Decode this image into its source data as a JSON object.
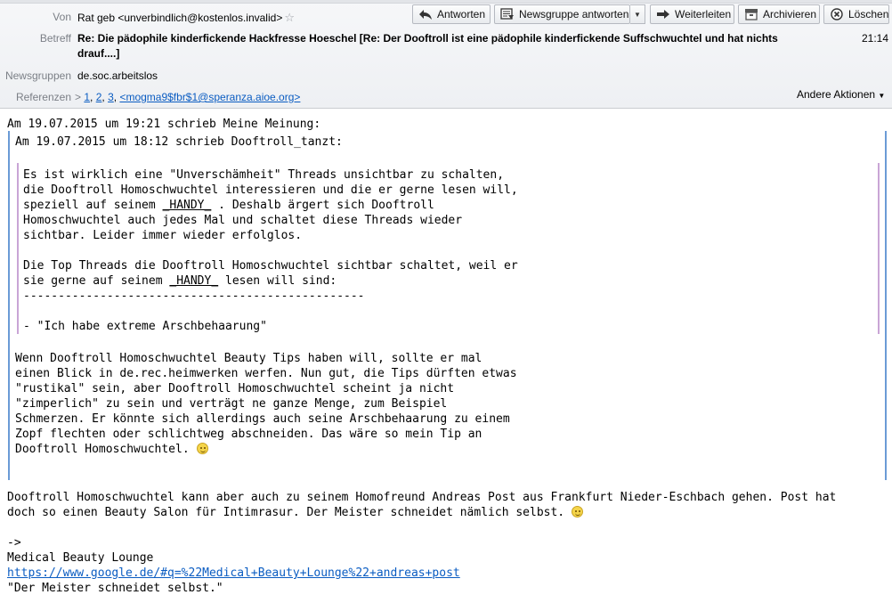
{
  "header": {
    "from_label": "Von",
    "from_value": "Rat geb <unverbindlich@kostenlos.invalid>",
    "subject_label": "Betreff",
    "subject_line1": "Re: Die pädophile kinderfickende Hackfresse Hoeschel [Re: Der Dooftroll ist eine pädophile kinderfickende Suffschwuchtel und hat nichts",
    "subject_line2": "drauf....]",
    "time": "21:14",
    "newsgroups_label": "Newsgruppen",
    "newsgroups_value": "de.soc.arbeitslos",
    "references_label": "Referenzen",
    "ref_1": "1",
    "ref_2": "2",
    "ref_3": "3",
    "ref_msgid": "<mogma9$fbr$1@speranza.aioe.org>",
    "other_actions": "Andere Aktionen"
  },
  "toolbar": {
    "reply": "Antworten",
    "reply_newsgroup": "Newsgruppe antworten",
    "forward": "Weiterleiten",
    "archive": "Archivieren",
    "delete": "Löschen"
  },
  "body": {
    "attribution_outer": "Am 19.07.2015 um 19:21 schrieb Meine Meinung:",
    "attribution_inner": "Am 19.07.2015 um 18:12 schrieb Dooftroll_tanzt:",
    "q2_l1": "Es ist wirklich eine \"Unverschämheit\" Threads unsichtbar zu schalten,",
    "q2_l2": "die Dooftroll Homoschwuchtel interessieren und die er gerne lesen will,",
    "q2_l3a": "speziell auf seinem ",
    "q2_l3b": "_HANDY_",
    "q2_l3c": " . Deshalb ärgert sich Dooftroll",
    "q2_l4": "Homoschwuchtel auch jedes Mal und schaltet diese Threads wieder",
    "q2_l5": "sichtbar. Leider immer wieder erfolglos.",
    "q2_l6": "Die Top Threads die Dooftroll Homoschwuchtel sichtbar schaltet, weil er",
    "q2_l7a": "sie gerne auf seinem ",
    "q2_l7b": "_HANDY_",
    "q2_l7c": " lesen will sind:",
    "q2_l8": "-------------------------------------------------",
    "q2_l9": "- \"Ich habe extreme Arschbehaarung\"",
    "q1_l1": "Wenn Dooftroll Homoschwuchtel Beauty Tips haben will, sollte er mal",
    "q1_l2": "einen Blick in de.rec.heimwerken werfen. Nun gut, die Tips dürften etwas",
    "q1_l3": "\"rustikal\" sein, aber Dooftroll Homoschwuchtel scheint ja nicht",
    "q1_l4": "\"zimperlich\" zu sein und verträgt ne ganze Menge, zum Beispiel",
    "q1_l5": "Schmerzen. Er könnte sich allerdings auch seine Arschbehaarung zu einem",
    "q1_l6": "Zopf flechten oder schlichtweg abschneiden. Das wäre so mein Tip an",
    "q1_l7": "Dooftroll Homoschwuchtel. ",
    "p_l1": "Dooftroll Homoschwuchtel kann aber auch zu seinem Homofreund Andreas Post aus Frankfurt Nieder-Eschbach gehen. Post hat",
    "p_l2": "doch so einen Beauty Salon für Intimrasur. Der Meister schneidet nämlich selbst. ",
    "sig_arrow": "->",
    "sig_name": "Medical Beauty Lounge",
    "sig_url": "https://www.google.de/#q=%22Medical+Beauty+Lounge%22+andreas+post",
    "sig_quote": "\"Der Meister schneidet selbst.\""
  }
}
